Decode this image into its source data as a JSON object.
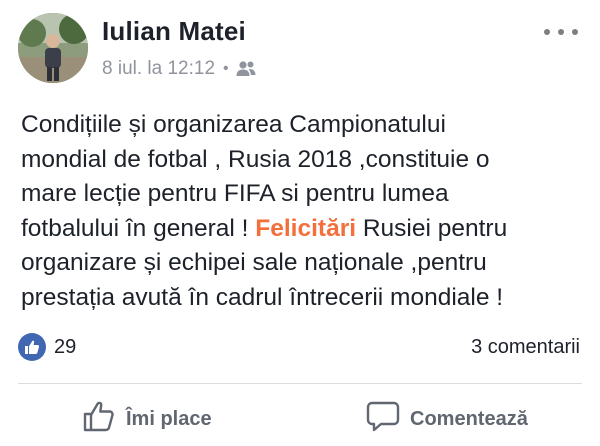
{
  "post": {
    "author": "Iulian Matei",
    "timestamp": "8 iul. la 12:12",
    "separator": "•",
    "audience_icon": "friends-icon",
    "text_lines": [
      "Condițiile și organizarea Campionatului",
      "mondial de fotbal , Rusia 2018 ,constituie o",
      "mare lecție pentru FIFA si pentru lumea",
      "fotbalului  în general ! ",
      "organizare și echipei sale naționale ,pentru",
      "prestația avută în cadrul întrecerii mondiale !"
    ],
    "line4_highlight": "Felicitări",
    "line4_tail": " Rusiei pentru",
    "highlight_color": "#f36f3b"
  },
  "stats": {
    "like_count": "29",
    "comments": "3 comentarii"
  },
  "actions": {
    "like_label": "Îmi place",
    "comment_label": "Comentează"
  },
  "colors": {
    "like_blue": "#4267b2",
    "secondary_text": "#90949c",
    "action_text": "#606770"
  }
}
